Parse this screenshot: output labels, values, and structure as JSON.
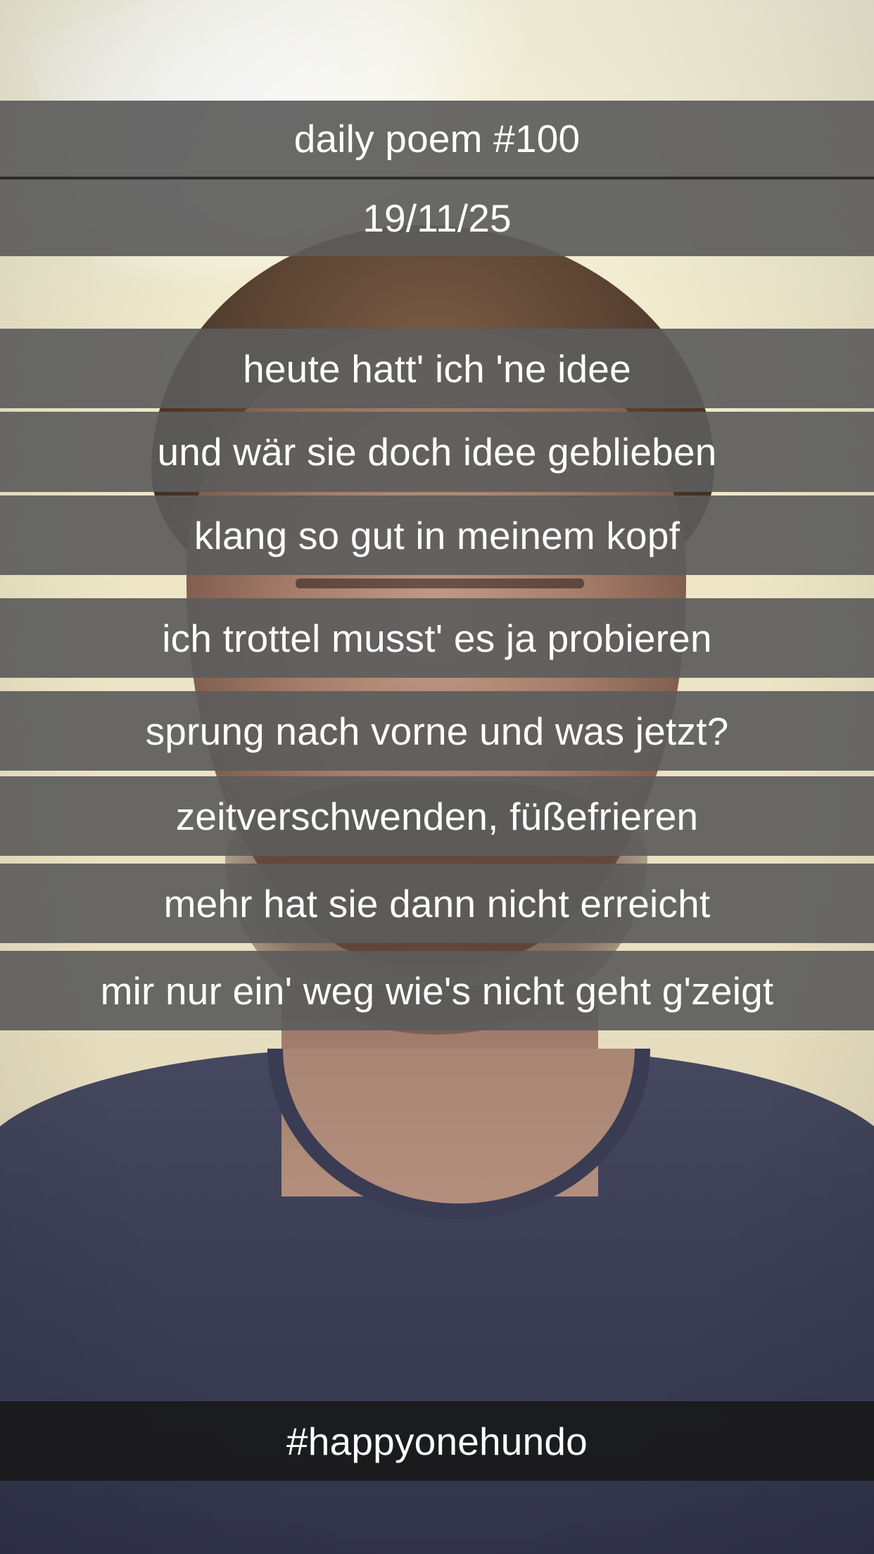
{
  "background": {
    "description_icon": "selfie-photo"
  },
  "header": {
    "title": "daily poem #100",
    "date": "19/11/25"
  },
  "poem": {
    "lines": [
      "heute hatt' ich 'ne idee",
      "und wär sie doch idee geblieben",
      "klang so gut in meinem kopf",
      "ich trottel musst' es ja probieren",
      "sprung nach vorne und was jetzt?",
      "zeitverschwenden, füßefrieren",
      "mehr hat sie dann nicht erreicht",
      "mir nur ein' weg wie's nicht geht g'zeigt"
    ]
  },
  "footer": {
    "hashtag": "#happyonehundo"
  },
  "colors": {
    "bar": "#5c5c5c",
    "footer_bar": "#181818",
    "text": "#ffffff"
  }
}
